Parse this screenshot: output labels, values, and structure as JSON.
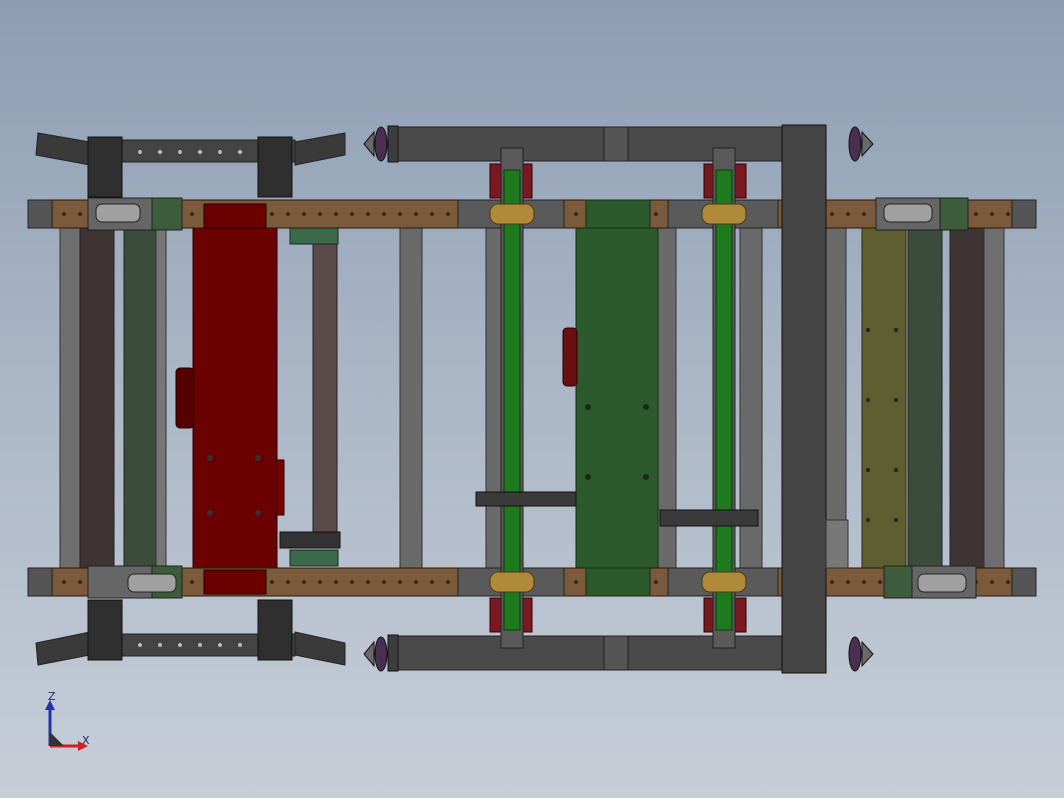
{
  "viewport": {
    "background_top": "#8d9db3",
    "background_bottom": "#c7ced8"
  },
  "colors": {
    "rail_brown": "#7a5a3a",
    "red_panel": "#6b0000",
    "green_panel": "#2c5a2c",
    "olive_panel": "#5e5e30",
    "green_shaft": "#1f7a1f",
    "frame_gray": "#4a4a4a",
    "dark_bar": "#3e3a3a",
    "wheel_purple": "#4a3050"
  },
  "axis_triad": {
    "z_label": "Z",
    "x_label": "X",
    "z_color": "#2233aa",
    "x_color": "#cc2222"
  }
}
